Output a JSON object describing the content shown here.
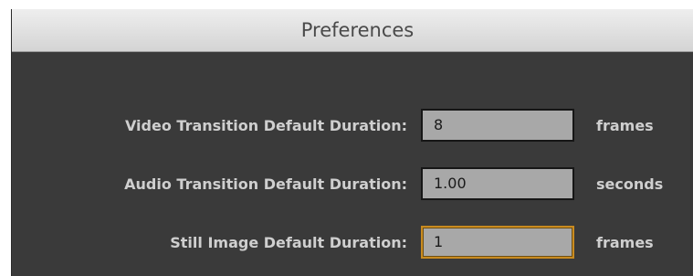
{
  "window": {
    "title": "Preferences"
  },
  "fields": [
    {
      "label": "Video Transition Default Duration:",
      "value": "8",
      "unit": "frames"
    },
    {
      "label": "Audio Transition Default Duration:",
      "value": "1.00",
      "unit": "seconds"
    },
    {
      "label": "Still Image Default Duration:",
      "value": "1",
      "unit": "frames",
      "focused": true
    }
  ],
  "colors": {
    "panel": "#3a3a3a",
    "focus_ring": "#c98b20",
    "field_bg": "#a8a8a8"
  }
}
